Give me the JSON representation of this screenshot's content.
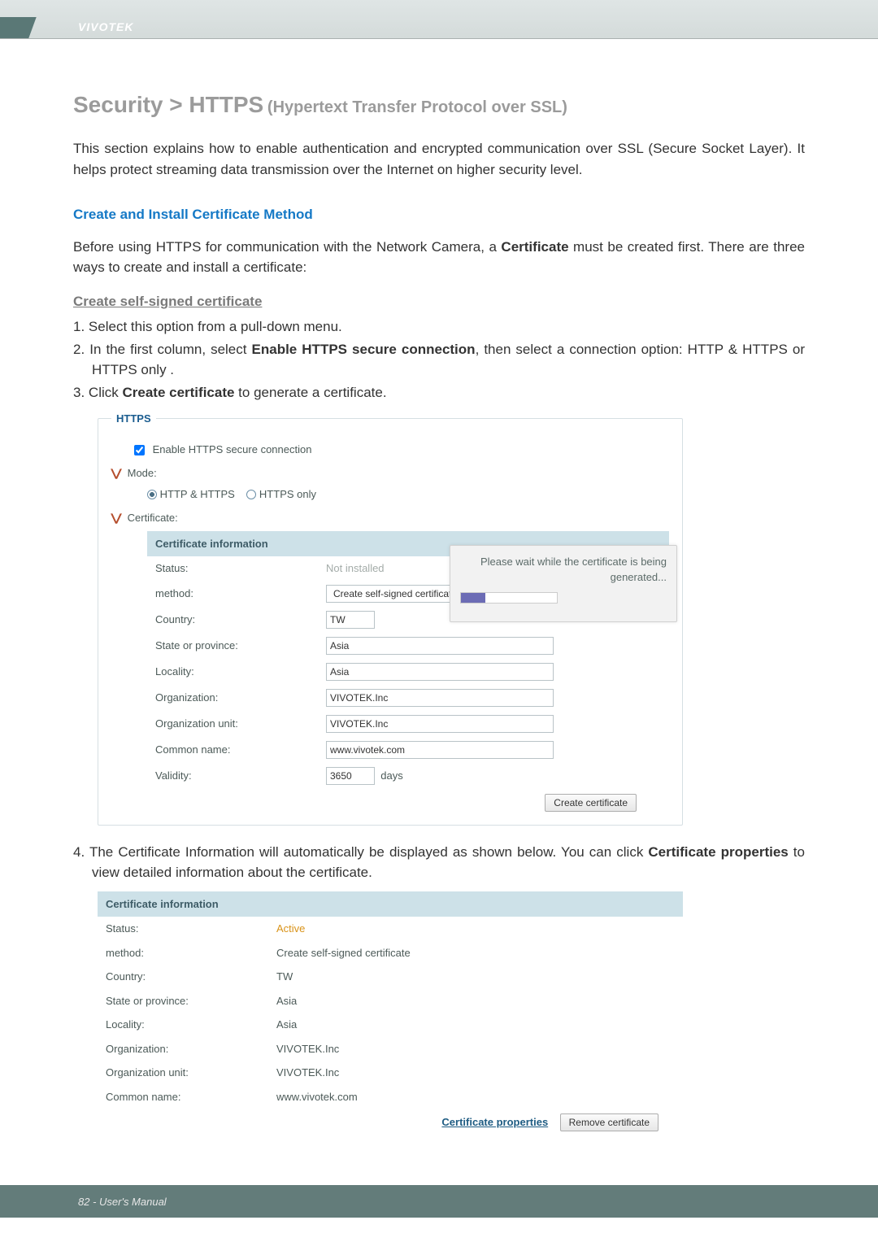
{
  "header": {
    "brand": "VIVOTEK"
  },
  "page": {
    "breadcrumb_main": "Security >  HTTPS",
    "breadcrumb_sub": "(Hypertext Transfer Protocol over SSL)",
    "intro": "This section explains how to enable authentication and encrypted communication over SSL (Secure Socket Layer). It helps protect streaming data transmission over the Internet on higher security level.",
    "section_title": "Create and Install Certificate Method",
    "section_intro_a": "Before using HTTPS for communication with the Network Camera, a ",
    "section_intro_b": "Certificate",
    "section_intro_c": " must be created first. There are three ways to create and install a certificate:",
    "subsection_title": "Create self-signed certificate",
    "steps": [
      "Select this option from a pull-down menu.",
      "In the first column, select Enable HTTPS secure connection, then select a connection option: HTTP & HTTPS  or  HTTPS only .",
      "Click Create certificate to generate a certificate."
    ],
    "step2_prefix": "In the first column, select ",
    "step2_bold": "Enable HTTPS secure connection",
    "step2_suffix": ", then select a connection option: HTTP & HTTPS  or  HTTPS only .",
    "step3_prefix": "Click ",
    "step3_bold": "Create certificate",
    "step3_suffix": " to generate a certificate.",
    "step4_a": "The Certificate Information will automatically be displayed as shown below. You can click ",
    "step4_b": "Certificate properties",
    "step4_c": " to view detailed information about the certificate."
  },
  "panel1": {
    "legend": "HTTPS",
    "enable_label": "Enable HTTPS secure connection",
    "mode_label": "Mode:",
    "mode_http_https": "HTTP & HTTPS",
    "mode_https_only": "HTTPS only",
    "certificate_label": "Certificate:",
    "cert_header": "Certificate information",
    "rows": {
      "status_lbl": "Status:",
      "status_val": "Not installed",
      "method_lbl": "method:",
      "method_val": "Create self-signed certificate",
      "country_lbl": "Country:",
      "country_val": "TW",
      "state_lbl": "State or province:",
      "state_val": "Asia",
      "locality_lbl": "Locality:",
      "locality_val": "Asia",
      "org_lbl": "Organization:",
      "org_val": "VIVOTEK.Inc",
      "orgunit_lbl": "Organization unit:",
      "orgunit_val": "VIVOTEK.Inc",
      "cn_lbl": "Common name:",
      "cn_val": "www.vivotek.com",
      "validity_lbl": "Validity:",
      "validity_val": "3650",
      "validity_suffix": "days"
    },
    "popup": {
      "line1": "Please wait while the certificate is being",
      "line2": "generated..."
    },
    "create_btn": "Create certificate"
  },
  "panel2": {
    "cert_header": "Certificate information",
    "rows": {
      "status_lbl": "Status:",
      "status_val": "Active",
      "method_lbl": "method:",
      "method_val": "Create self-signed certificate",
      "country_lbl": "Country:",
      "country_val": "TW",
      "state_lbl": "State or province:",
      "state_val": "Asia",
      "locality_lbl": "Locality:",
      "locality_val": "Asia",
      "org_lbl": "Organization:",
      "org_val": "VIVOTEK.Inc",
      "orgunit_lbl": "Organization unit:",
      "orgunit_val": "VIVOTEK.Inc",
      "cn_lbl": "Common name:",
      "cn_val": "www.vivotek.com"
    },
    "cert_props_link": "Certificate properties",
    "remove_btn": "Remove certificate"
  },
  "footer": {
    "text": "82 - User's Manual"
  }
}
